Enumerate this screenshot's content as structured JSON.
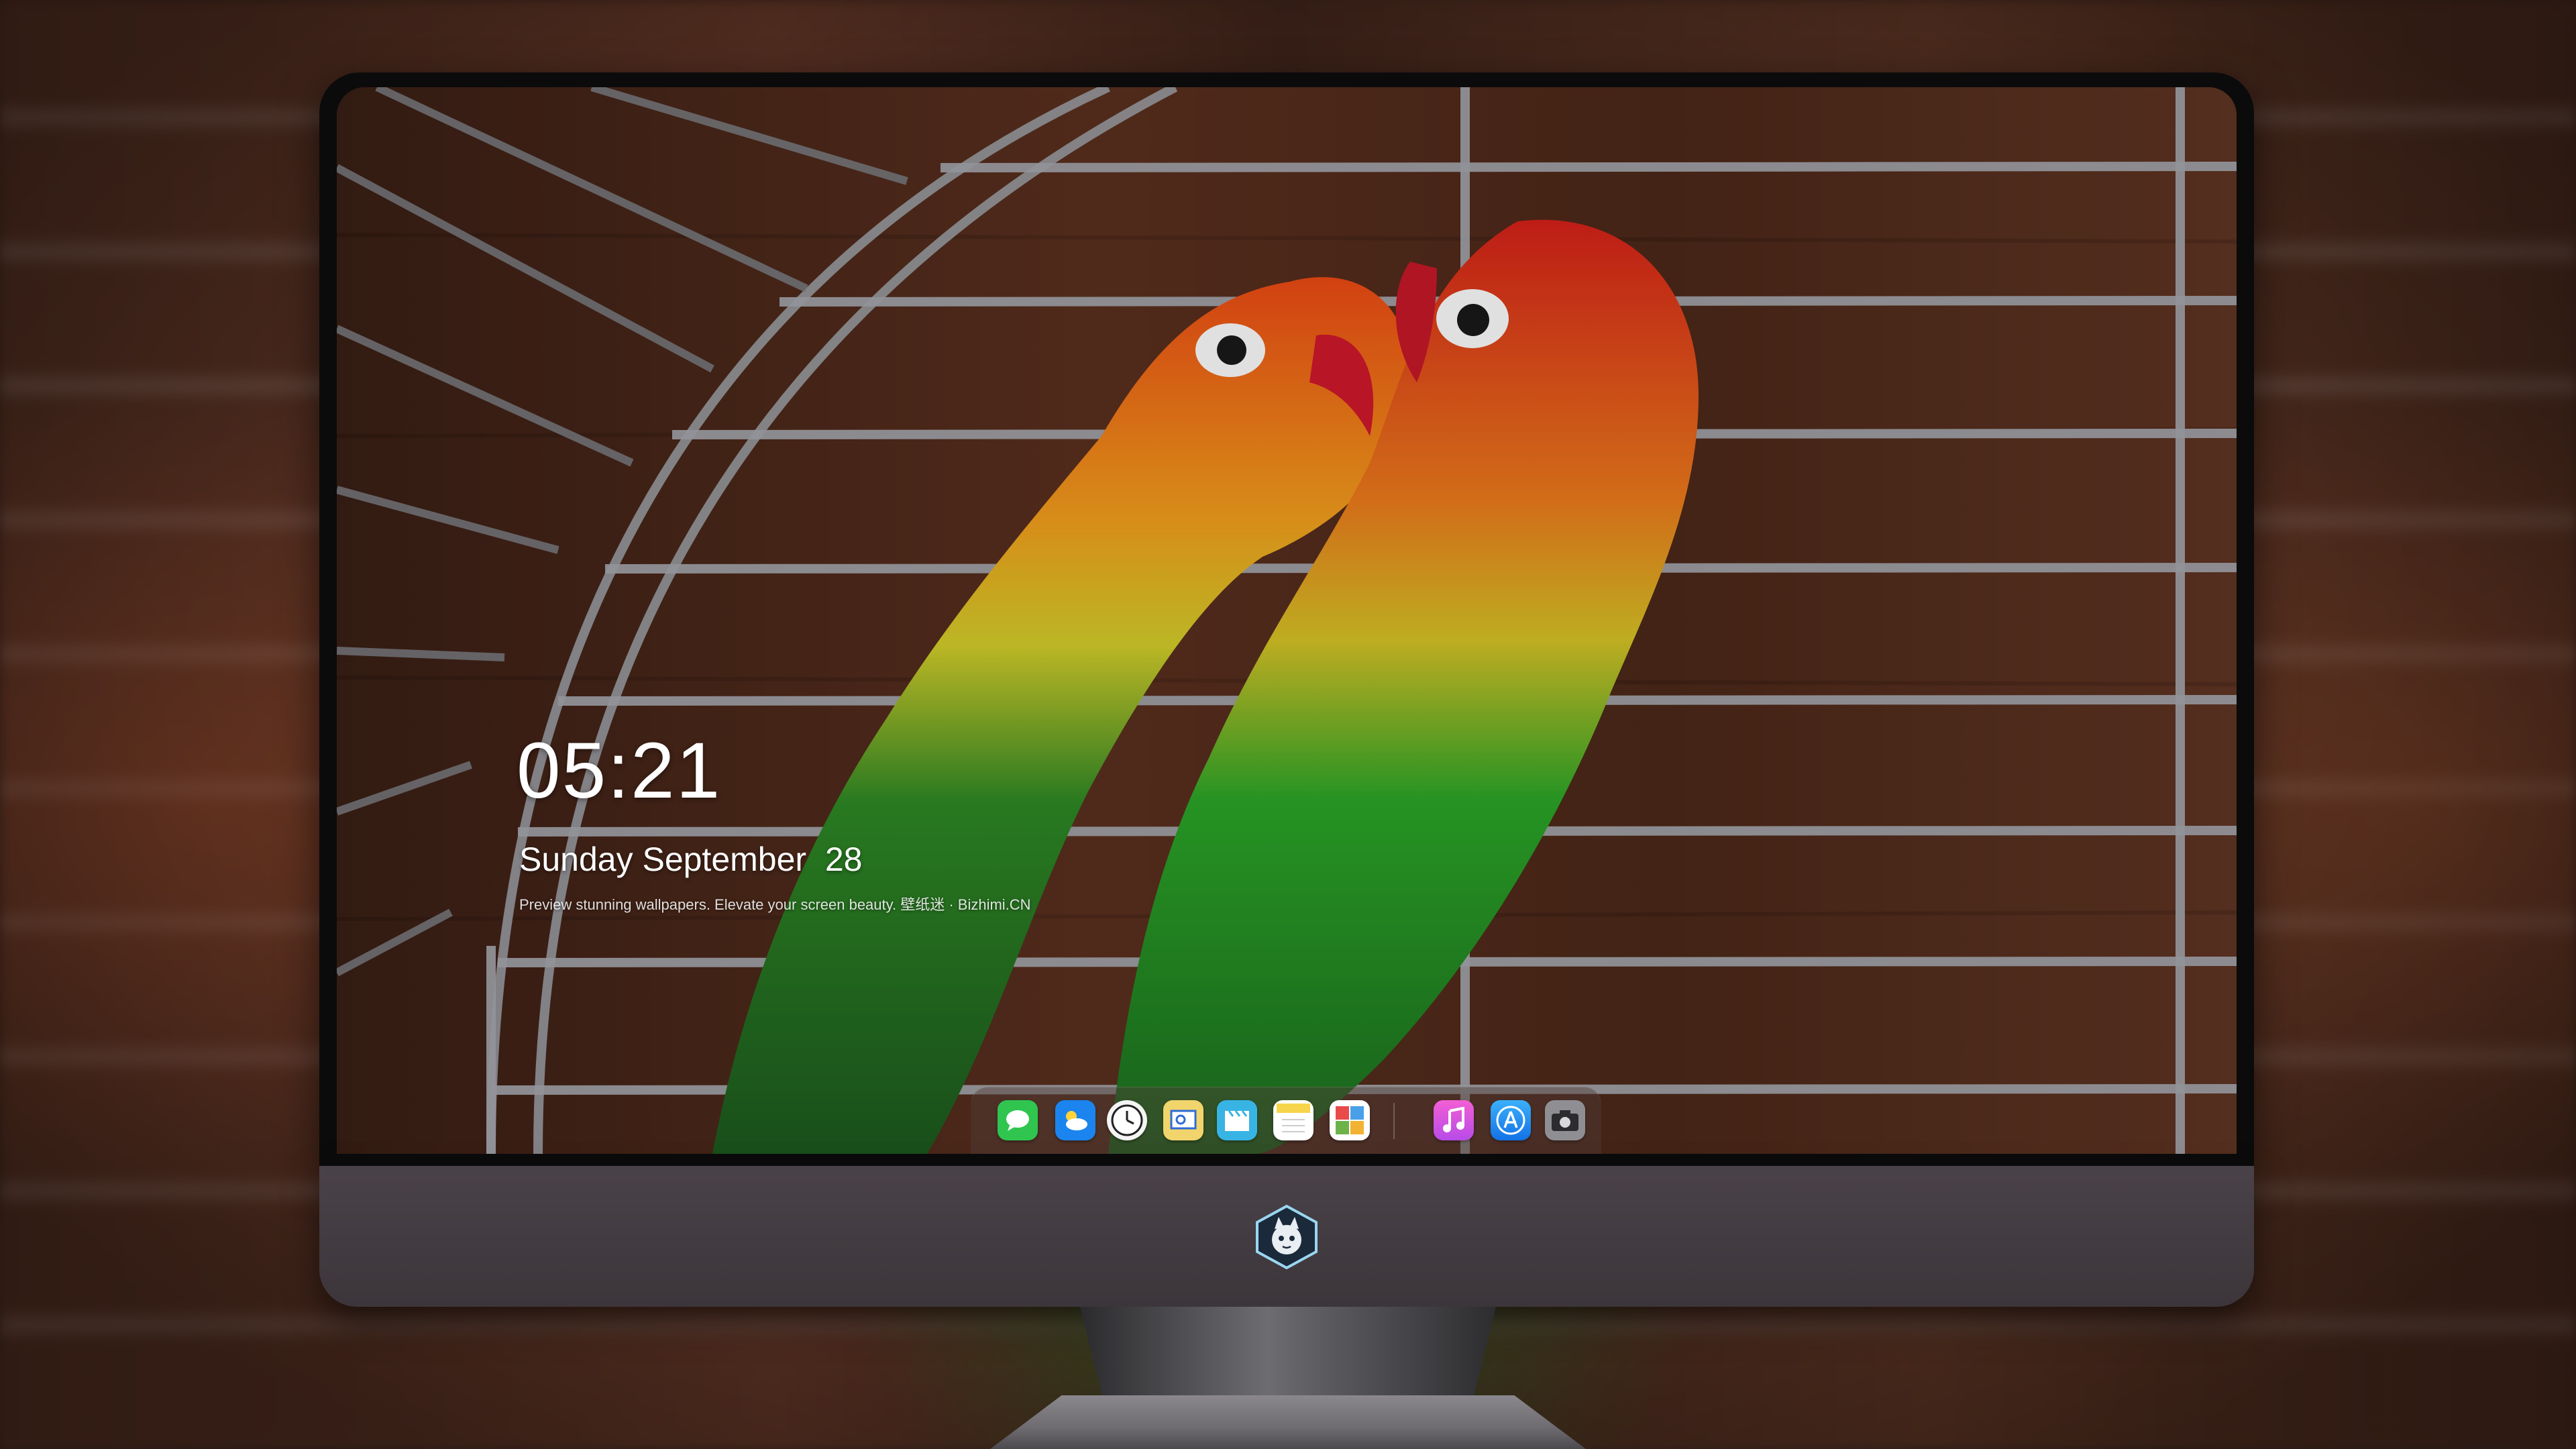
{
  "lock_screen": {
    "time": "05:21",
    "date": "Sunday September  28",
    "tagline": "Preview stunning wallpapers. Elevate your screen beauty. 壁纸迷 · Bizhimi.CN"
  },
  "dock": {
    "apps": [
      {
        "name": "messages-icon",
        "color": "#33c759"
      },
      {
        "name": "weather-icon",
        "color": "#1e88f0"
      },
      {
        "name": "clock-icon",
        "color": "#f2f2f2"
      },
      {
        "name": "preview-icon",
        "color": "#f3d36a"
      },
      {
        "name": "claquette-icon",
        "color": "#3cb8e6"
      },
      {
        "name": "notes-icon",
        "color": "#f7d54a"
      },
      {
        "name": "photos-grid-icon",
        "color": "#6db34a"
      },
      {
        "name": "itunes-icon",
        "color": "#f046c8"
      },
      {
        "name": "app-store-icon",
        "color": "#1a8cf5"
      },
      {
        "name": "camera-icon",
        "color": "#8e8e93"
      }
    ]
  },
  "colors": {
    "bezel": "#0b0b0c",
    "chin": "#443e43",
    "text": "#ffffff"
  }
}
